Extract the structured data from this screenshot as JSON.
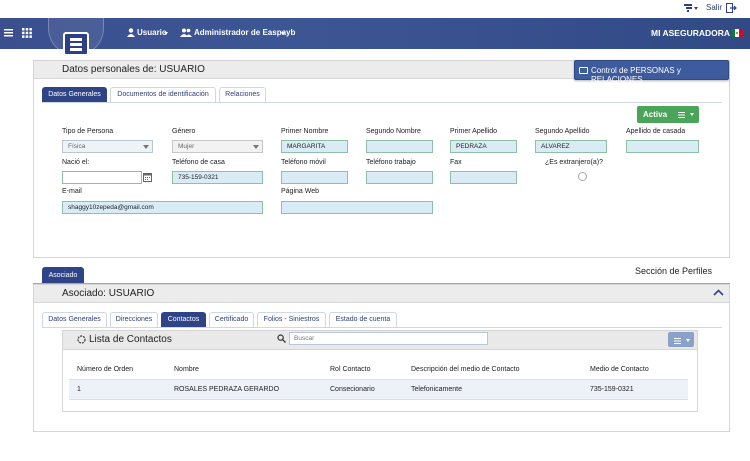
{
  "topbar": {
    "exit_label": "Salir"
  },
  "navbar": {
    "user_menu": "Usuario",
    "admin_menu": "Administrador de Easpayb",
    "brand": "MI ASEGURADORA"
  },
  "personal": {
    "title": "Datos personales de: USUARIO",
    "control_button": "Control de PERSONAS y RELACIONES",
    "tabs": [
      "Datos Generales",
      "Documentos de identificación",
      "Relaciones"
    ],
    "status_button": "Activa",
    "fields": {
      "tipo_persona_label": "Tipo de Persona",
      "tipo_persona_value": "Física",
      "genero_label": "Género",
      "genero_value": "Mujer",
      "primer_nombre_label": "Primer Nombre",
      "primer_nombre_value": "MARGARITA",
      "segundo_nombre_label": "Segundo Nombre",
      "segundo_nombre_value": "",
      "primer_apellido_label": "Primer Apellido",
      "primer_apellido_value": "PEDRAZA",
      "segundo_apellido_label": "Segundo Apellido",
      "segundo_apellido_value": "ALVAREZ",
      "apellido_casada_label": "Apellido de casada",
      "apellido_casada_value": "",
      "nacio_label": "Nació el:",
      "nacio_value": "",
      "tel_casa_label": "Teléfono de casa",
      "tel_casa_value": "735-159-0321",
      "tel_movil_label": "Teléfono móvil",
      "tel_movil_value": "",
      "tel_trabajo_label": "Teléfono trabajo",
      "tel_trabajo_value": "",
      "fax_label": "Fax",
      "fax_value": "",
      "extranjero_label": "¿Es extranjero(a)?",
      "email_label": "E-mail",
      "email_value": "shaggy10zepeda@gmail.com",
      "web_label": "Página Web",
      "web_value": ""
    }
  },
  "profiles": {
    "tab_label": "Asociado",
    "section_title": "Sección de Perfiles"
  },
  "associate": {
    "title": "Asociado: USUARIO",
    "tabs": [
      "Datos Generales",
      "Direcciones",
      "Contactos",
      "Certificado",
      "Folios - Siniestros",
      "Estado de cuenta"
    ],
    "contacts": {
      "title": "Lista de Contactos",
      "search_placeholder": "Buscar",
      "columns": [
        "Número de Orden",
        "Nombre",
        "Rol Contacto",
        "Descripción del medio de Contacto",
        "Medio de Contacto"
      ],
      "rows": [
        [
          "1",
          "ROSALES PEDRAZA GERARDO",
          "Consecionario",
          "Telefonicamente",
          "735-159-0321"
        ]
      ]
    }
  }
}
